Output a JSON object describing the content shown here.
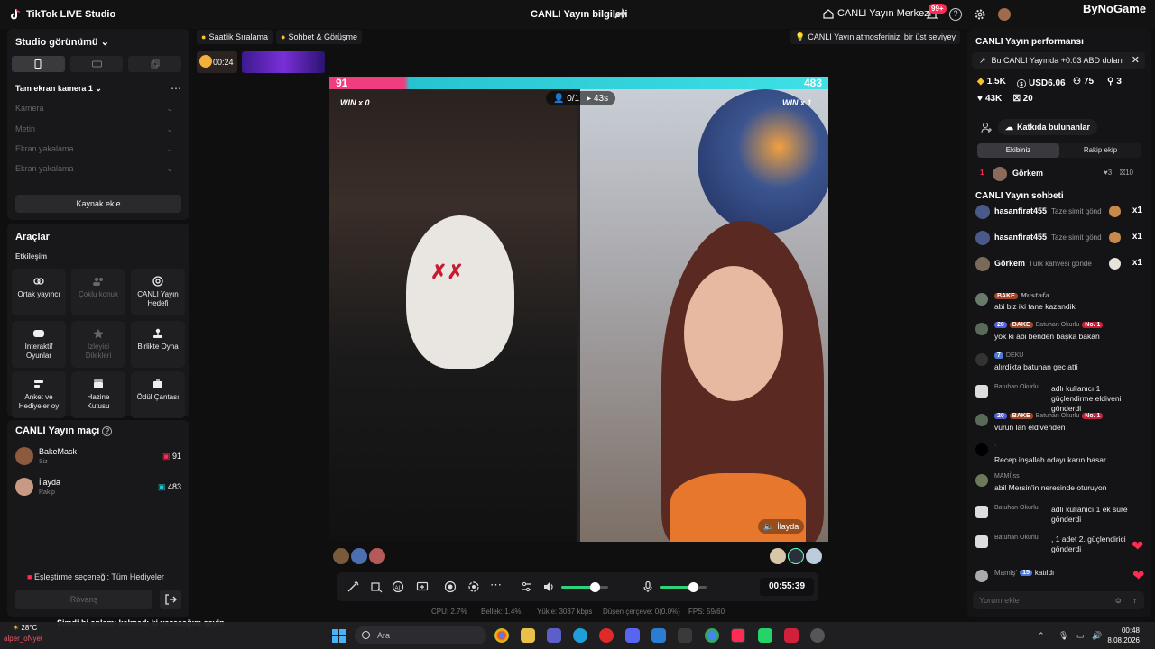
{
  "topbar": {
    "app_title": "TikTok LIVE Studio",
    "center_title": "CANLI Yayın bilgileri",
    "center_link": "CANLI Yayın Merkezi",
    "notif_badge": "99+",
    "help_glyph": "?",
    "brand": "ByNoGame"
  },
  "studio": {
    "title": "Studio görünümü",
    "camera_label": "Tam ekran kamera 1",
    "sources": [
      "Kamera",
      "Metin",
      "Ekran yakalama",
      "Ekran yakalama"
    ],
    "add_source": "Kaynak ekle"
  },
  "tools": {
    "title": "Araçlar",
    "sub": "Etkileşim",
    "items": [
      {
        "label1": "Ortak yayıncı",
        "label2": ""
      },
      {
        "label1": "Çoklu konuk",
        "label2": ""
      },
      {
        "label1": "CANLI Yayın",
        "label2": "Hedefi"
      },
      {
        "label1": "İnteraktif",
        "label2": "Oyunlar"
      },
      {
        "label1": "İzleyici",
        "label2": "Dilekleri"
      },
      {
        "label1": "Birlikte Oyna",
        "label2": ""
      },
      {
        "label1": "Anket ve",
        "label2": "Hediyeler oy"
      },
      {
        "label1": "Hazine",
        "label2": "Kutusu"
      },
      {
        "label1": "Ödül Çantası",
        "label2": ""
      }
    ]
  },
  "match": {
    "title": "CANLI Yayın maçı",
    "players": [
      {
        "name": "BakeMask",
        "role": "Siz",
        "score": "91"
      },
      {
        "name": "İlayda",
        "role": "Rakip",
        "score": "483"
      }
    ],
    "pair_option": "Eşleştirme seçeneği: Tüm Hediyeler",
    "rematch": "Rövanş"
  },
  "chips": {
    "ranking": "Saatlik Sıralama",
    "chat": "Sohbet & Görüşme",
    "tip": "CANLI Yayın atmosferinizi bir üst seviyeye ...",
    "thumb_time": "00:24"
  },
  "stage": {
    "score_left": "91",
    "score_right": "483",
    "win_left": "WIN x 0",
    "win_right": "WIN x 1",
    "guests": "0/1",
    "countdown": "43s",
    "guest_tag": "İlayda"
  },
  "controls": {
    "volume_level": 0.72,
    "mic_level": 0.72,
    "elapsed": "00:55:39"
  },
  "stats": {
    "cpu": "CPU: 2.7%",
    "memory": "Bellek: 1.4%",
    "upload": "Yükle: 3037 kbps",
    "dropped": "Düşen çerçeve: 0(0.0%)",
    "fps": "FPS: 59/60"
  },
  "performance": {
    "title": "CANLI Yayın performansı",
    "banner": "Bu CANLI Yayında +0.03 ABD doları",
    "metrics": {
      "likes": "1.5K",
      "usd": "USD6.06",
      "viewers": "75",
      "shares": "3",
      "followers": "43K",
      "gifts": "20"
    },
    "contributors_button": "Katkıda bulunanlar",
    "team_tabs": [
      "Ekibiniz",
      "Rakip ekip"
    ],
    "top_contributor": {
      "rank": "1",
      "name": "Görkem",
      "hearts": "3",
      "gifts": "10"
    }
  },
  "chat": {
    "title": "CANLI Yayın sohbeti",
    "gifts": [
      {
        "user": "hasanfirat455",
        "text": "Taze simit gönd",
        "count": "x1"
      },
      {
        "user": "hasanfirat455",
        "text": "Taze simit gönd",
        "count": "x1"
      },
      {
        "user": "Görkem",
        "text": "Türk kahvesi gönderdi",
        "count": "x1"
      }
    ],
    "messages": [
      {
        "badges": "BAKE",
        "level": "",
        "user": "𝙈𝙪𝙨𝙩𝙖𝙛𝙖",
        "text": "abi biz iki tane kazandik"
      },
      {
        "badges": "BAKE",
        "level": "20",
        "user": "Batuhan Okurlu",
        "tag": "No. 1",
        "text": "yok ki abi benden başka bakan"
      },
      {
        "badges": "",
        "level": "7",
        "user": "DEKU",
        "text": "alırdikta batuhan gec atti"
      },
      {
        "badges": "",
        "level": "",
        "user": "Batuhan Okurlu",
        "text": "adlı kullanıcı 1 güçlendirme eldiveni gönderdi"
      },
      {
        "badges": "BAKE",
        "level": "20",
        "user": "Batuhan Okurlu",
        "tag": "No. 1",
        "text": "vurun lan eldivenden"
      },
      {
        "badges": "",
        "level": "",
        "user": "·",
        "text": "Recep inşallah odayı karın basar"
      },
      {
        "badges": "",
        "level": "",
        "user": "MAMİ)ss",
        "text": "abil Mersin'in neresinde oturuyon"
      },
      {
        "badges": "",
        "level": "",
        "user": "Batuhan Okurlu",
        "text": "adlı kullanıcı 1 ek süre gönderdi"
      },
      {
        "badges": "",
        "level": "",
        "user": "Batuhan Okurlu",
        "text": ", 1 adet 2. güçlendirici gönderdi"
      },
      {
        "badges": "",
        "level": "15",
        "user": "Mamiş'",
        "text": "katıldı"
      }
    ],
    "comment_placeholder": "Yorum ekle"
  },
  "overlay": {
    "caption": "Şimdi bi anlamı kalmadı ki yazacağım şeyin",
    "username": "alper_oNyet"
  },
  "taskbar": {
    "weather": "28°C",
    "search": "Ara",
    "time": "00:48",
    "date": "8.08.2026"
  }
}
